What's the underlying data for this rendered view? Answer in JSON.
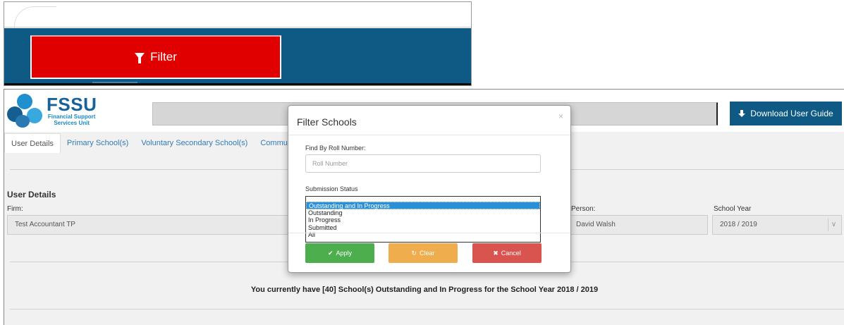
{
  "inset": {
    "filter_button": {
      "label": "Filter",
      "icon": "filter-icon"
    }
  },
  "header": {
    "logo": {
      "title": "FSSU",
      "subtitle_line1": "Financial Support",
      "subtitle_line2": "Services Unit"
    },
    "download_button": {
      "label": "Download User Guide",
      "icon": "download-icon"
    }
  },
  "tabs": [
    {
      "label": "User Details",
      "active": true
    },
    {
      "label": "Primary School(s)",
      "active": false
    },
    {
      "label": "Voluntary Secondary School(s)",
      "active": false
    },
    {
      "label": "Community and Co",
      "active": false
    }
  ],
  "user_details": {
    "title": "User Details",
    "firm_label": "Firm:",
    "firm_value": "Test Accountant TP",
    "person_label": "Person:",
    "person_value": "David Walsh",
    "school_year_label": "School Year",
    "school_year_value": "2018 / 2019"
  },
  "summary": {
    "text": "You currently have [40] School(s) Outstanding and In Progress for the School Year 2018 / 2019"
  },
  "modal": {
    "title": "Filter Schools",
    "close_symbol": "×",
    "roll_label": "Find By Roll Number:",
    "roll_placeholder": "Roll Number",
    "roll_value": "",
    "status_label": "Submission Status",
    "status_options": [
      "Outstanding and In Progress",
      "Outstanding",
      "In Progress",
      "Submitted",
      "All"
    ],
    "status_selected": "Outstanding and In Progress",
    "buttons": {
      "apply": {
        "label": "Apply",
        "glyph": "✔"
      },
      "clear": {
        "label": "Clear",
        "glyph": "↻"
      },
      "cancel": {
        "label": "Cancel",
        "glyph": "✖"
      }
    }
  },
  "colors": {
    "brand_blue": "#0e5a85",
    "filter_red": "#e00000",
    "apply_green": "#4cae4c",
    "clear_orange": "#f0ad4e",
    "cancel_red": "#d9534f",
    "selected_option": "#2b8fd8"
  }
}
